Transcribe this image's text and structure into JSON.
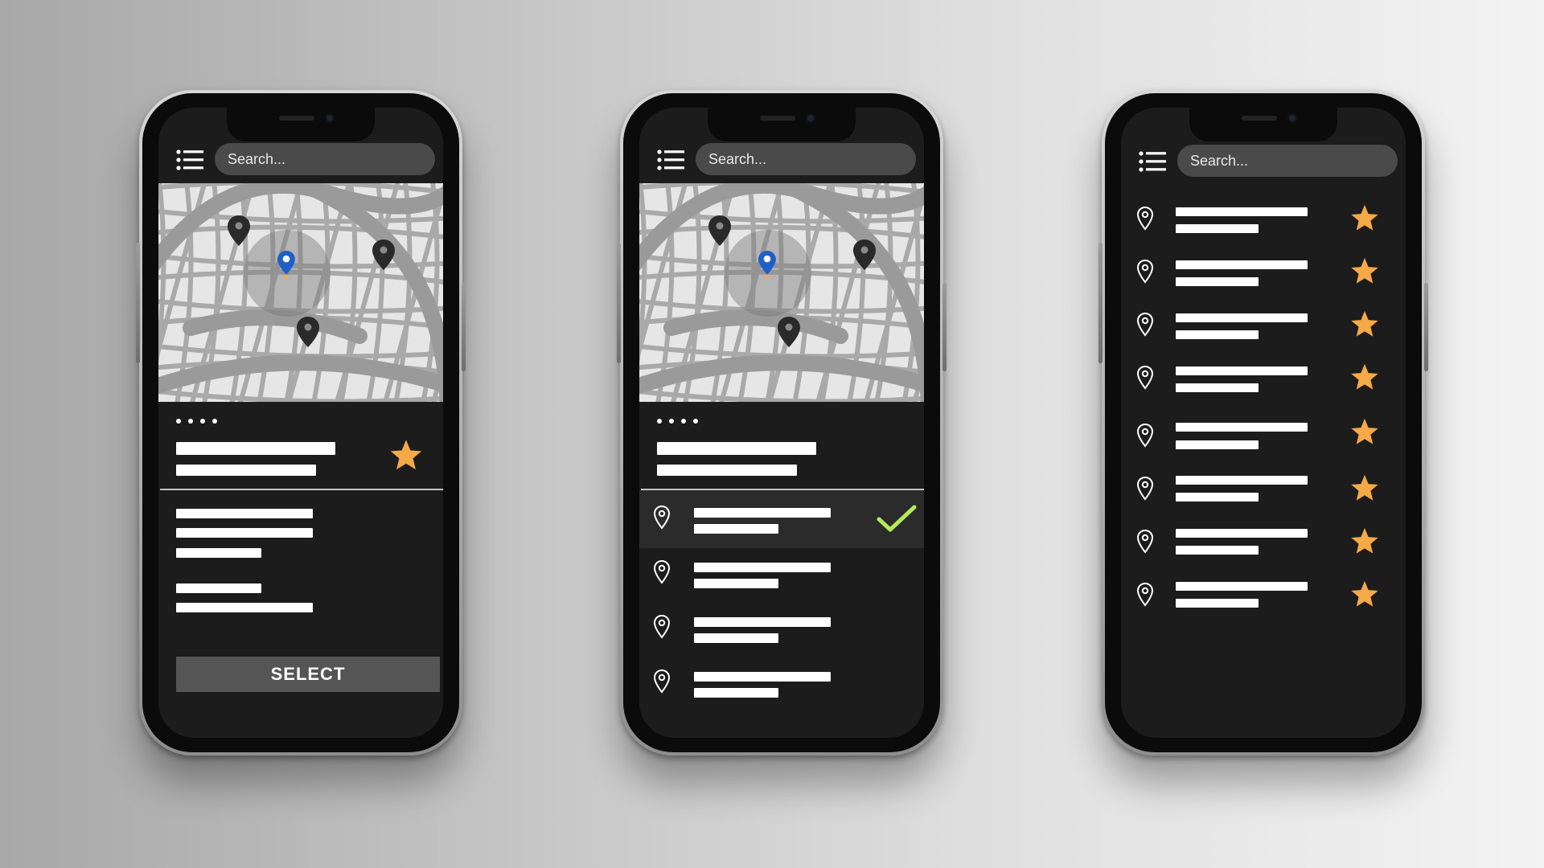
{
  "search": {
    "placeholder": "Search..."
  },
  "detail_screen": {
    "select_label": "SELECT"
  },
  "list_screen": {
    "location_count": 4,
    "selected_index": 0
  },
  "favorites_screen": {
    "favorite_count": 8
  },
  "icons": {
    "menu": "menu-list-icon",
    "location": "location-pin-outline-icon",
    "favorite": "star-icon",
    "selected": "checkmark-icon",
    "map_marker": "map-marker-icon",
    "current_location": "current-location-marker-icon"
  },
  "colors": {
    "screen_bg": "#1c1c1c",
    "search_bg": "#4a4a4a",
    "star": "#f5a947",
    "check": "#b4ea59",
    "current_marker": "#1f5fc8",
    "select_button": "#555555"
  }
}
